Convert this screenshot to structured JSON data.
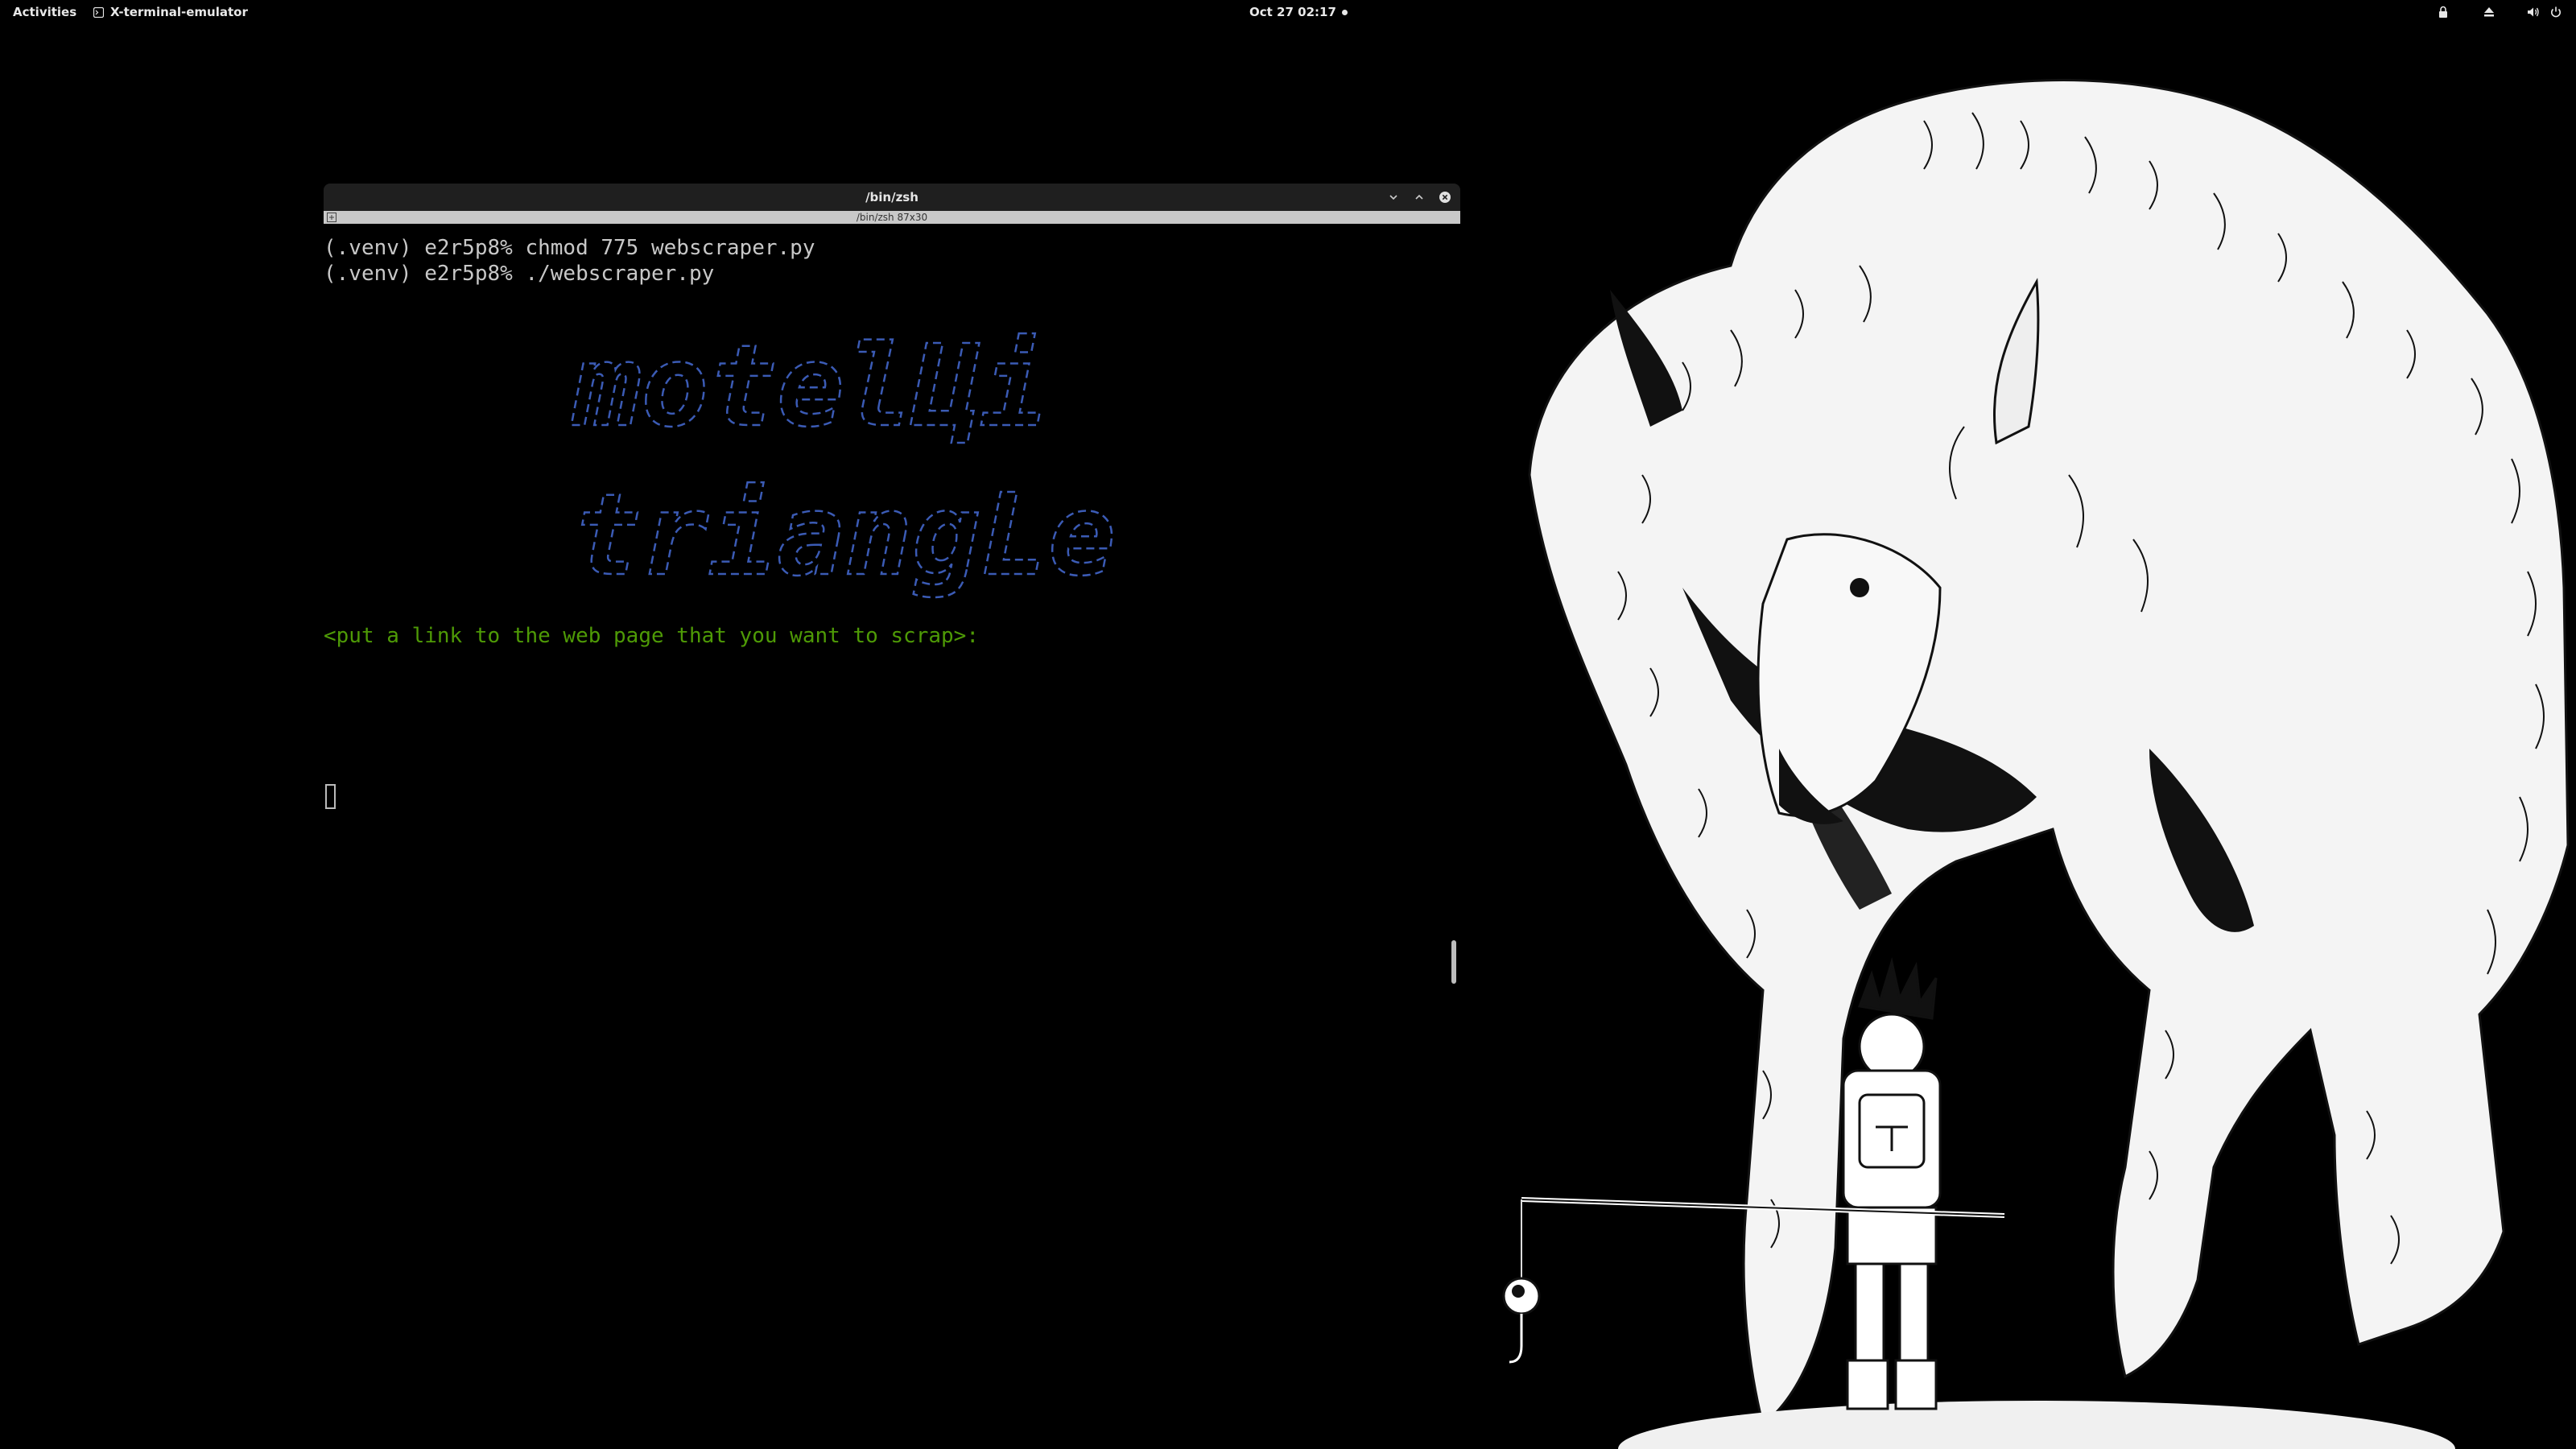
{
  "topbar": {
    "activities_label": "Activities",
    "app_name": "X-terminal-emulator",
    "clock": "Oct 27  02:17",
    "tray_icons": [
      "lock-icon",
      "eject-icon",
      "volume-icon",
      "power-icon"
    ]
  },
  "terminal": {
    "window_title": "/bin/zsh",
    "tab_label": "/bin/zsh 87x30",
    "lines": [
      "(.venv) e2r5p8% chmod 775 webscraper.py",
      "(.venv) e2r5p8% ./webscraper.py"
    ],
    "banner_line1": "motelЦi",
    "banner_line2": "triangLe",
    "prompt": "<put a link to the web page that you want to scrap>:",
    "colors": {
      "text": "#c8c8c8",
      "prompt_green": "#4e9a06",
      "banner_blue": "#3b5bb5"
    }
  },
  "wallpaper": {
    "subject": "monochrome ink illustration of a giant furry beast looming over a spiky-haired boy holding a fishing rod"
  }
}
